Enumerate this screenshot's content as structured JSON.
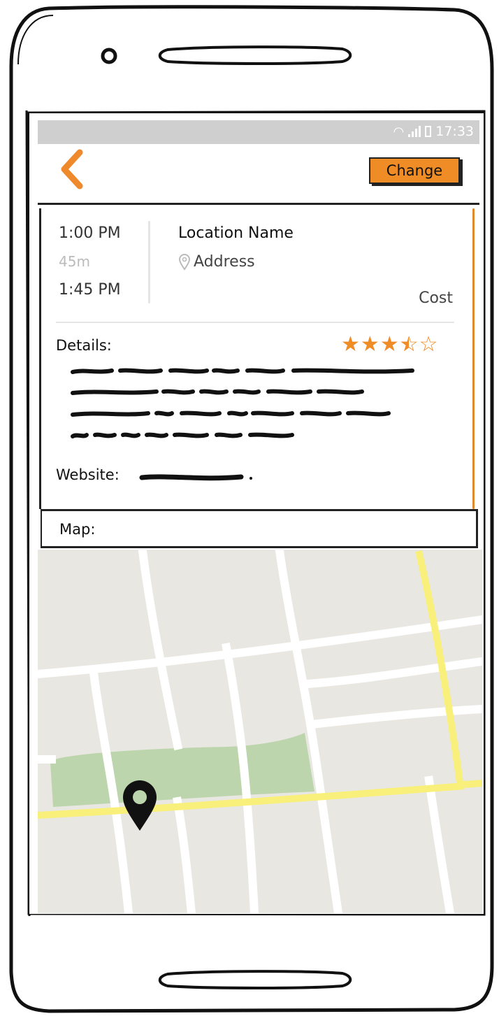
{
  "status_bar": {
    "time": "17:33"
  },
  "header": {
    "back_icon": "chevron-left-icon",
    "change_label": "Change"
  },
  "event": {
    "start_time": "1:00 PM",
    "duration": "45m",
    "end_time": "1:45 PM",
    "location_name": "Location Name",
    "address": "Address",
    "cost_label": "Cost"
  },
  "details": {
    "label": "Details:",
    "rating": 3.5,
    "rating_max": 5,
    "website_label": "Website:"
  },
  "map": {
    "label": "Map:"
  },
  "colors": {
    "accent": "#f08c26",
    "star": "#f08c26",
    "map_bg": "#e9e7e1",
    "park": "#bcd5ac",
    "highway": "#f8f07a"
  }
}
